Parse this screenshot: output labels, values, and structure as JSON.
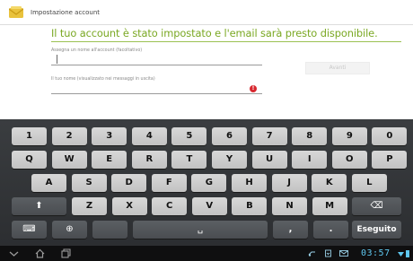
{
  "window": {
    "title": "Impostazione account"
  },
  "setup": {
    "heading": "Il tuo account è stato impostato e l'email sarà presto disponibile.",
    "account_name_label": "Assegna un nome all'account (facoltativo)",
    "account_name_value": "",
    "your_name_label": "Il tuo nome (visualizzato nei messaggi in uscita)",
    "your_name_value": "",
    "next_button": "Avanti",
    "error_symbol": "!"
  },
  "keyboard": {
    "row1": [
      "1",
      "2",
      "3",
      "4",
      "5",
      "6",
      "7",
      "8",
      "9",
      "0"
    ],
    "row2": [
      "Q",
      "W",
      "E",
      "R",
      "T",
      "Y",
      "U",
      "I",
      "O",
      "P"
    ],
    "row3": [
      "A",
      "S",
      "D",
      "F",
      "G",
      "H",
      "J",
      "K",
      "L"
    ],
    "row4": [
      "Z",
      "X",
      "C",
      "V",
      "B",
      "N",
      "M"
    ],
    "comma": ",",
    "period": ".",
    "done_label": "Eseguito",
    "shift_symbol": "⬆",
    "backspace_symbol": "⌫",
    "space_symbol": "␣",
    "globe_symbol": "⊕",
    "settings_symbol": "⌨"
  },
  "statusbar": {
    "clock": "03:57"
  },
  "colors": {
    "accent": "#7aa823",
    "keyboard_bg": "#2c2e31",
    "key_light": "#d0d0d0",
    "key_dark": "#4f5256",
    "clock": "#5fc8f0",
    "error": "#d8282f"
  }
}
